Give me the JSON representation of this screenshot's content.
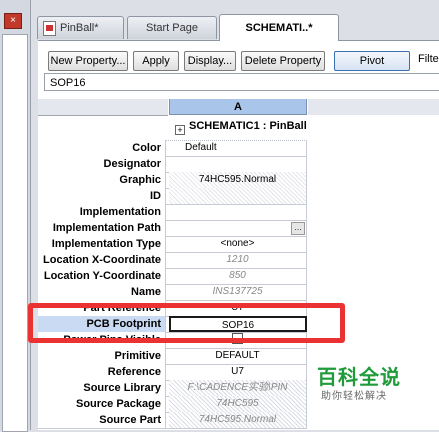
{
  "left_panel": {
    "close_glyph": "×"
  },
  "tabs": [
    {
      "label": "PinBall*"
    },
    {
      "label": "Start Page"
    },
    {
      "label": "SCHEMATI..*"
    }
  ],
  "toolbar": {
    "new_property": "New Property...",
    "apply": "Apply",
    "display": "Display...",
    "delete_property": "Delete Property",
    "pivot": "Pivot",
    "filter_label": "Filte",
    "value": "SOP16"
  },
  "grid": {
    "column_a": "A",
    "title": "SCHEMATIC1 : PinBall",
    "rows": [
      {
        "label": "Color",
        "value": "Default"
      },
      {
        "label": "Designator",
        "value": ""
      },
      {
        "label": "Graphic",
        "value": "74HC595.Normal"
      },
      {
        "label": "ID",
        "value": ""
      },
      {
        "label": "Implementation",
        "value": ""
      },
      {
        "label": "Implementation Path",
        "value": ""
      },
      {
        "label": "Implementation Type",
        "value": "<none>"
      },
      {
        "label": "Location X-Coordinate",
        "value": "1210"
      },
      {
        "label": "Location Y-Coordinate",
        "value": "850"
      },
      {
        "label": "Name",
        "value": "INS137725"
      },
      {
        "label": "Part Reference",
        "value": "U7"
      },
      {
        "label": "PCB Footprint",
        "value": "SOP16"
      },
      {
        "label": "Power Pins Visible",
        "value": ""
      },
      {
        "label": "Primitive",
        "value": "DEFAULT"
      },
      {
        "label": "Reference",
        "value": "U7"
      },
      {
        "label": "Source Library",
        "value": "F:\\CADENCE实验\\PIN"
      },
      {
        "label": "Source Package",
        "value": "74HC595"
      },
      {
        "label": "Source Part",
        "value": "74HC595.Normal"
      }
    ]
  },
  "watermark": {
    "title": "百科全说",
    "subtitle": "助你轻松解决"
  },
  "colors": {
    "highlight": "#ea3232",
    "column_header": "#a9c6ea",
    "watermark": "#1f9b3a"
  }
}
